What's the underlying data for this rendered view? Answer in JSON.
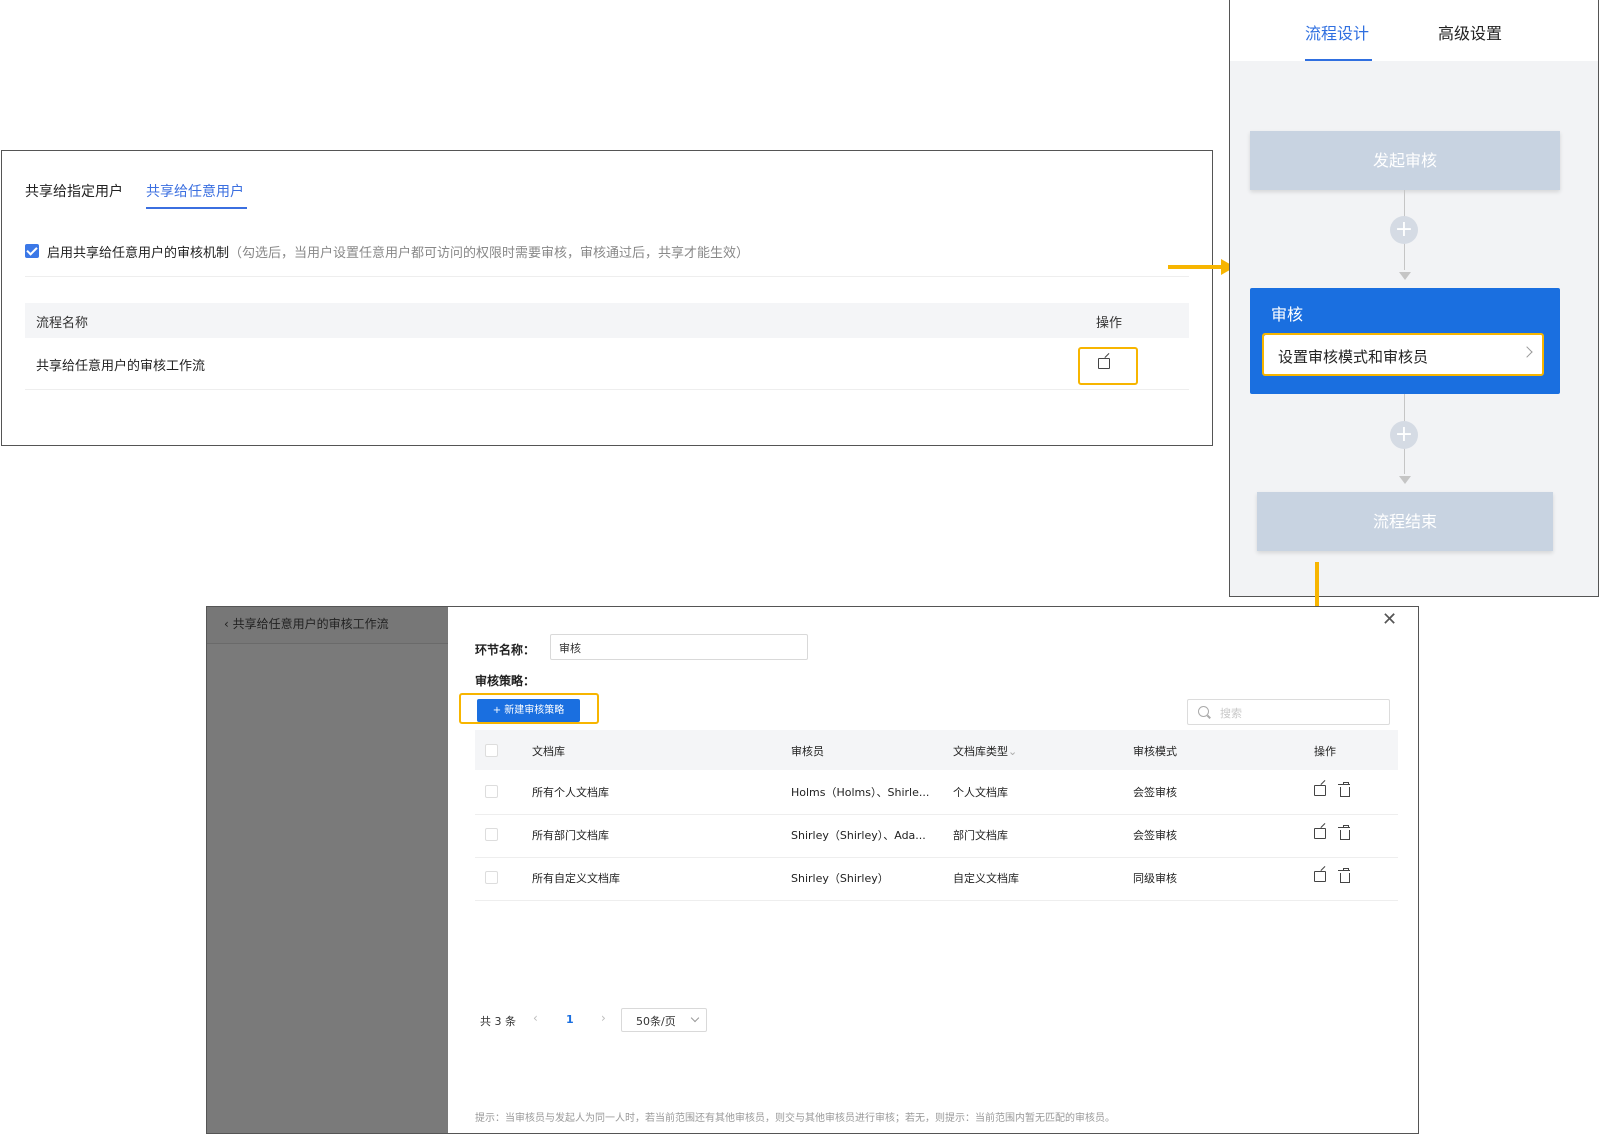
{
  "share_panel": {
    "tabs": [
      "共享给指定用户",
      "共享给任意用户"
    ],
    "enable_label": "启用共享给任意用户的审核机制",
    "enable_hint": "（勾选后，当用户设置任意用户都可访问的权限时需要审核，审核通过后，共享才能生效）",
    "table": {
      "headers": {
        "name": "流程名称",
        "action": "操作"
      },
      "rows": [
        {
          "name": "共享给任意用户的审核工作流"
        }
      ]
    }
  },
  "flow_panel": {
    "tabs": [
      "流程设计",
      "高级设置"
    ],
    "start_node": "发起审核",
    "review_node": {
      "title": "审核",
      "item": "设置审核模式和审核员"
    },
    "end_node": "流程结束"
  },
  "config_panel": {
    "back_title": "共享给任意用户的审核工作流",
    "node_name_label": "环节名称：",
    "node_name_value": "审核",
    "strategy_label": "审核策略：",
    "new_button": "新建审核策略",
    "search_placeholder": "搜索",
    "columns": [
      "文档库",
      "审核员",
      "文档库类型",
      "审核模式",
      "操作"
    ],
    "rows": [
      {
        "library": "所有个人文档库",
        "reviewer": "Holms（Holms）、Shirle...",
        "type": "个人文档库",
        "mode": "会签审核"
      },
      {
        "library": "所有部门文档库",
        "reviewer": "Shirley（Shirley）、Ada...",
        "type": "部门文档库",
        "mode": "会签审核"
      },
      {
        "library": "所有自定义文档库",
        "reviewer": "Shirley（Shirley）",
        "type": "自定义文档库",
        "mode": "同级审核"
      }
    ],
    "pagination": {
      "total": "共 3 条",
      "current_page": "1",
      "page_size": "50条/页"
    },
    "hint": "提示：当审核员与发起人为同一人时，若当前范围还有其他审核员，则交与其他审核员进行审核；若无，则提示：当前范围内暂无匹配的审核员。"
  },
  "colors": {
    "accent": "#1a6fe0",
    "highlight": "#f7b500",
    "node_grey": "#c8d3e1"
  }
}
